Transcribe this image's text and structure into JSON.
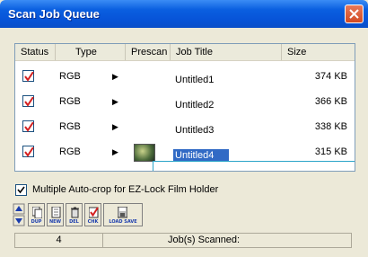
{
  "window": {
    "title": "Scan Job Queue"
  },
  "columns": [
    {
      "label": "Status"
    },
    {
      "label": "Type"
    },
    {
      "label": "Prescan"
    },
    {
      "label": "Job Title"
    },
    {
      "label": "Size"
    }
  ],
  "jobs": [
    {
      "checked": true,
      "type": "RGB",
      "title": "Untitled1",
      "size": "374 KB",
      "has_prescan": false,
      "selected": false
    },
    {
      "checked": true,
      "type": "RGB",
      "title": "Untitled2",
      "size": "366 KB",
      "has_prescan": false,
      "selected": false
    },
    {
      "checked": true,
      "type": "RGB",
      "title": "Untitled3",
      "size": "338 KB",
      "has_prescan": false,
      "selected": false
    },
    {
      "checked": true,
      "type": "RGB",
      "title": "Untitled4",
      "size": "315 KB",
      "has_prescan": true,
      "selected": true
    }
  ],
  "options": {
    "auto_crop_label": "Multiple Auto-crop for EZ-Lock Film Holder",
    "auto_crop_checked": true
  },
  "toolbar": {
    "dup_label": "DUP",
    "new_label": "NEW",
    "del_label": "DEL",
    "chk_label": "CHK",
    "load_save_label": "LOAD SAVE"
  },
  "status": {
    "count": "4",
    "message": "Job(s) Scanned:"
  },
  "colors": {
    "selection": "#316ac5",
    "titlebar": "#0a5fe0",
    "check": "#d42020"
  }
}
